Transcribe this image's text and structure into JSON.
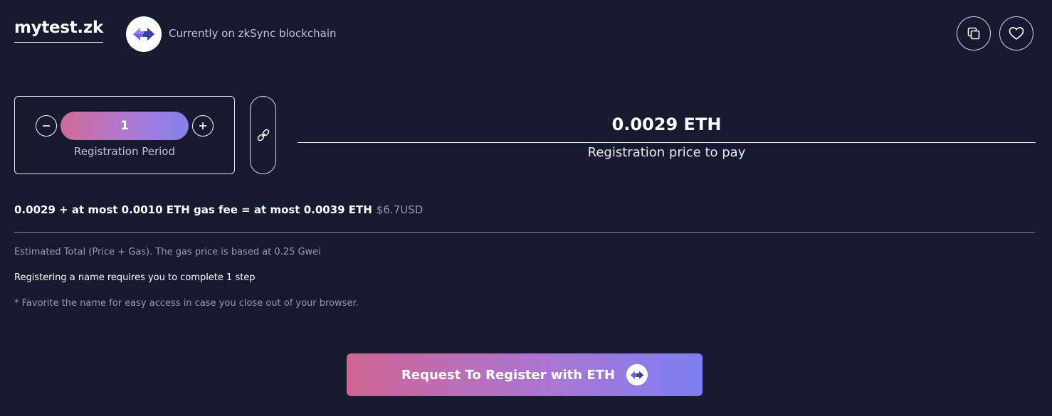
{
  "header": {
    "domain_name": "mytest.zk",
    "chain_text": "Currently on zkSync blockchain",
    "chain_icon": "zksync-logo-icon",
    "copy_icon": "copy-icon",
    "favorite_icon": "heart-icon"
  },
  "period": {
    "value": "1",
    "label": "Registration Period",
    "decrement_icon": "minus-circle-icon",
    "increment_icon": "plus-circle-icon"
  },
  "link_icon": "link-icon",
  "price": {
    "value": "0.0029 ETH",
    "label": "Registration price to pay"
  },
  "fee": {
    "breakdown": "0.0029 + at most 0.0010 ETH gas fee = at most 0.0039 ETH",
    "usd": "$6.7USD"
  },
  "notes": {
    "gas": "Estimated Total (Price + Gas). The gas price is based at 0.25 Gwei",
    "steps": "Registering a name requires you to complete 1 step",
    "favorite": "* Favorite the name for easy access in case you close out of your browser."
  },
  "register_button": {
    "label": "Request To Register with ETH",
    "icon": "zksync-logo-icon"
  },
  "colors": {
    "background": "#161a2e",
    "gradient_start": "#d06a96",
    "gradient_end": "#7c7ff2",
    "zksync_purple": "#6e64e0"
  }
}
